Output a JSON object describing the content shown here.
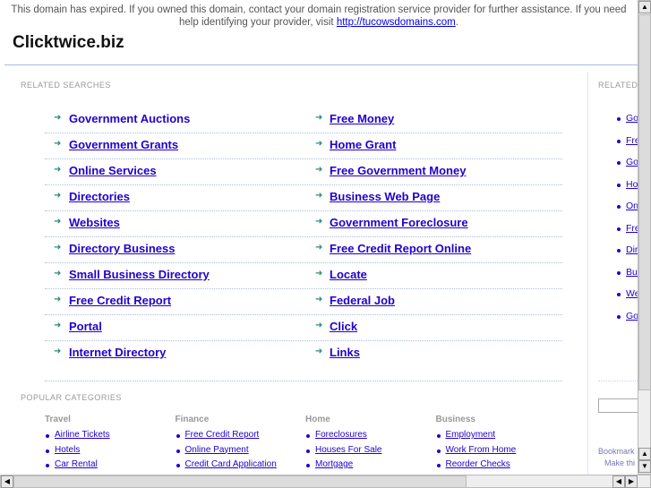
{
  "notice": {
    "text": "This domain has expired. If you owned this domain, contact your domain registration service provider for further assistance. If you need help identifying your provider, visit ",
    "link": "http://tucowsdomains.com",
    "end": "."
  },
  "title": "Clicktwice.biz",
  "related_heading": "RELATED SEARCHES",
  "related_left": [
    "Government Auctions",
    "Government Grants",
    "Online Services",
    "Directories",
    "Websites",
    "Directory Business",
    "Small Business Directory",
    "Free Credit Report",
    "Portal",
    "Internet Directory"
  ],
  "related_right": [
    "Free Money",
    "Home Grant",
    "Free Government Money",
    "Business Web Page",
    "Government Foreclosure",
    "Free Credit Report Online",
    "Locate",
    "Federal Job",
    "Click",
    "Links"
  ],
  "popular_heading": "POPULAR CATEGORIES",
  "categories": [
    {
      "name": "Travel",
      "items": [
        "Airline Tickets",
        "Hotels",
        "Car Rental"
      ]
    },
    {
      "name": "Finance",
      "items": [
        "Free Credit Report",
        "Online Payment",
        "Credit Card Application"
      ]
    },
    {
      "name": "Home",
      "items": [
        "Foreclosures",
        "Houses For Sale",
        "Mortgage"
      ]
    },
    {
      "name": "Business",
      "items": [
        "Employment",
        "Work From Home",
        "Reorder Checks"
      ]
    }
  ],
  "side": {
    "heading": "RELATED",
    "items": [
      "Go",
      "Fre",
      "Go",
      "Ho",
      "On",
      "Fre",
      "Dir",
      "Bus",
      "We",
      "Go"
    ],
    "bookmark": "Bookmark",
    "make": "Make thi"
  },
  "colors": {
    "link": "#2200cc",
    "arrow": "#2a8a80"
  }
}
